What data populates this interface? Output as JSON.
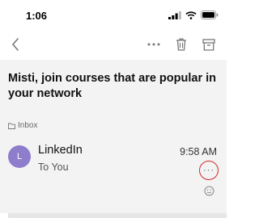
{
  "status_bar": {
    "time": "1:06"
  },
  "toolbar": {
    "icons": [
      "chevron-left-icon",
      "more-horizontal-icon",
      "trash-icon",
      "archive-icon"
    ]
  },
  "email": {
    "subject": "Misti, join courses that are popular in your network",
    "folder": "Inbox"
  },
  "message": {
    "avatar_initial": "L",
    "sender": "LinkedIn",
    "recipient": "To You",
    "time": "9:58 AM",
    "more_label": "···"
  },
  "colors": {
    "avatar": "#8e7ccc",
    "highlight_circle": "#d42a2a"
  }
}
